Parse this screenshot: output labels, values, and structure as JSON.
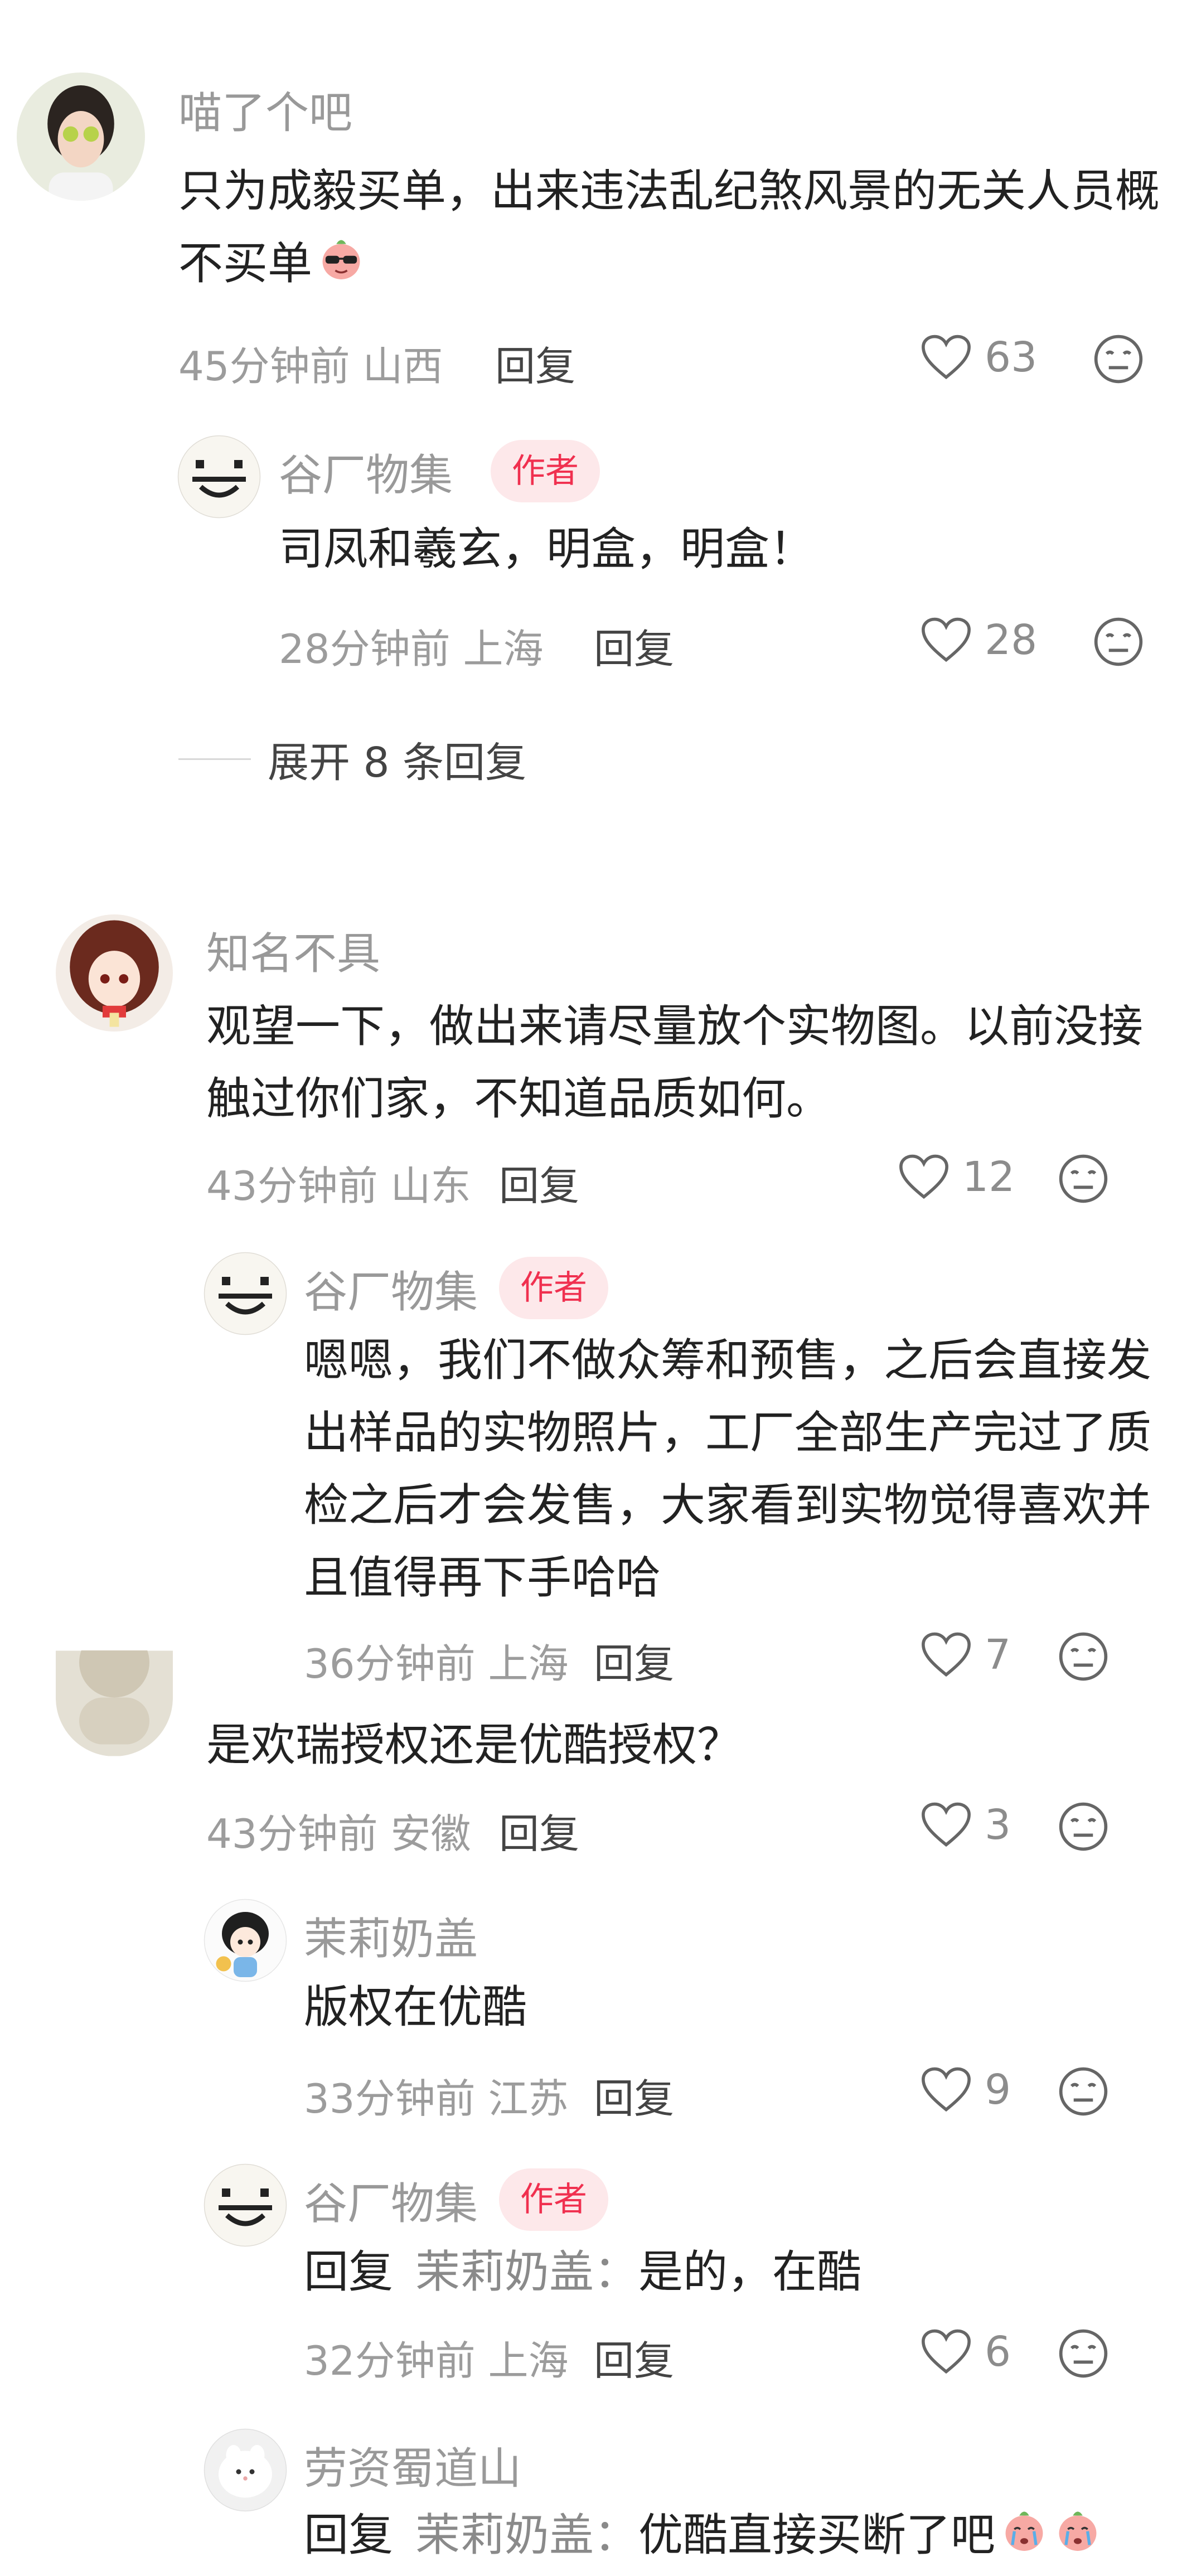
{
  "comments": [
    {
      "user": "喵了个吧",
      "text": "只为成毅买单，出来违法乱纪煞风景的无关人员概不买单",
      "time": "45分钟前",
      "location": "山西",
      "reply_label": "回复",
      "likes": "63",
      "replies": [
        {
          "user": "谷厂物集",
          "badge": "作者",
          "text": "司凤和羲玄，明盒，明盒！",
          "time": "28分钟前",
          "location": "上海",
          "reply_label": "回复",
          "likes": "28"
        }
      ],
      "expand_label": "展开 8 条回复"
    },
    {
      "user": "知名不具",
      "text": "观望一下，做出来请尽量放个实物图。以前没接触过你们家，不知道品质如何。",
      "time": "43分钟前",
      "location": "山东",
      "reply_label": "回复",
      "likes": "12",
      "replies": [
        {
          "user": "谷厂物集",
          "badge": "作者",
          "text": "嗯嗯，我们不做众筹和预售，之后会直接发出样品的实物照片，工厂全部生产完过了质检之后才会发售，大家看到实物觉得喜欢并且值得再下手哈哈",
          "time": "36分钟前",
          "location": "上海",
          "reply_label": "回复",
          "likes": "7"
        }
      ]
    },
    {
      "text": "是欢瑞授权还是优酷授权？",
      "time": "43分钟前",
      "location": "安徽",
      "reply_label": "回复",
      "likes": "3",
      "replies": [
        {
          "user": "茉莉奶盖",
          "text": "版权在优酷",
          "time": "33分钟前",
          "location": "江苏",
          "reply_label": "回复",
          "likes": "9"
        },
        {
          "user": "谷厂物集",
          "badge": "作者",
          "reply_prefix": "回复",
          "mention": "茉莉奶盖：",
          "text": "是的，在酷",
          "time": "32分钟前",
          "location": "上海",
          "reply_label": "回复",
          "likes": "6"
        },
        {
          "user": "劳资蜀道山",
          "reply_prefix": "回复",
          "mention": "茉莉奶盖：",
          "text": "优酷直接买断了吧"
        }
      ]
    }
  ],
  "icons": {
    "like": "heart-outline-icon",
    "dislike": "meh-face-icon",
    "emoji_sunglasses": "sunglasses-peach-emoji",
    "emoji_cry": "crying-peach-emoji"
  },
  "colors": {
    "background": "#ffffff",
    "text": "#222222",
    "muted": "#999999",
    "author_badge_bg": "#fde8ea",
    "author_badge_text": "#f0304f"
  }
}
